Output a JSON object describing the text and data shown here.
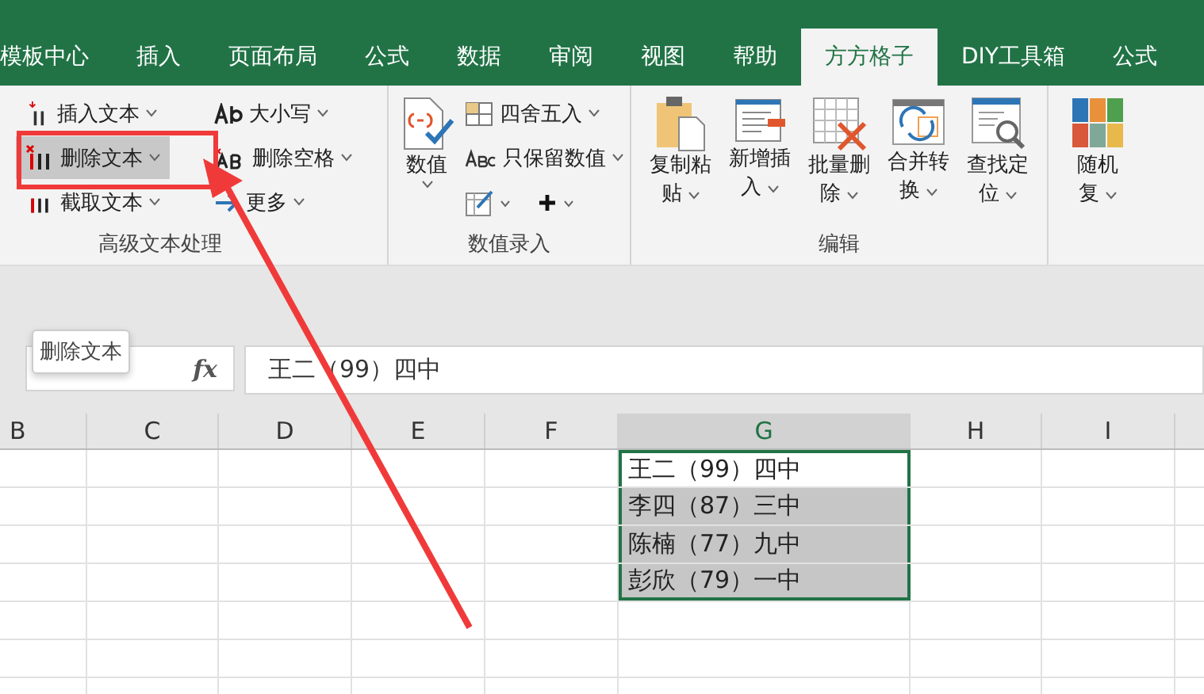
{
  "tabs": [
    {
      "label": "模板中心",
      "selected": false
    },
    {
      "label": "插入",
      "selected": false
    },
    {
      "label": "页面布局",
      "selected": false
    },
    {
      "label": "公式",
      "selected": false
    },
    {
      "label": "数据",
      "selected": false
    },
    {
      "label": "审阅",
      "selected": false
    },
    {
      "label": "视图",
      "selected": false
    },
    {
      "label": "帮助",
      "selected": false
    },
    {
      "label": "方方格子",
      "selected": true
    },
    {
      "label": "DIY工具箱",
      "selected": false
    },
    {
      "label": "公式",
      "selected": false
    }
  ],
  "ribbon": {
    "groups": [
      {
        "kind": "text-tools",
        "label": "高级文本处理",
        "columns": [
          [
            {
              "kind": "insert",
              "label": "插入文本",
              "hovered": false
            },
            {
              "kind": "delete",
              "label": "删除文本",
              "hovered": true
            },
            {
              "kind": "cut",
              "label": "截取文本",
              "hovered": false
            }
          ],
          [
            {
              "kind": "case",
              "label": "大小写",
              "hovered": false
            },
            {
              "kind": "space",
              "label": "删除空格",
              "hovered": false
            },
            {
              "kind": "more",
              "label": "更多",
              "hovered": false
            }
          ]
        ]
      },
      {
        "kind": "number-tools",
        "label": "数值录入",
        "big": {
          "label": "数值"
        },
        "items": [
          {
            "kind": "round",
            "label": "四舍五入"
          },
          {
            "kind": "keep",
            "label": "只保留数值"
          }
        ]
      },
      {
        "kind": "large-buttons",
        "label": "编辑",
        "buttons": [
          {
            "kind": "paste",
            "lines": [
              "复制粘",
              "贴"
            ]
          },
          {
            "kind": "insert-row",
            "lines": [
              "新增插",
              "入"
            ]
          },
          {
            "kind": "batch-delete",
            "lines": [
              "批量删",
              "除"
            ]
          },
          {
            "kind": "merge",
            "lines": [
              "合并转",
              "换"
            ]
          },
          {
            "kind": "find",
            "lines": [
              "查找定",
              "位"
            ]
          }
        ]
      },
      {
        "kind": "large-buttons",
        "buttons": [
          {
            "kind": "random",
            "lines": [
              "随机",
              "复"
            ]
          }
        ]
      }
    ]
  },
  "tooltip": {
    "text": "删除文本"
  },
  "formula_bar": {
    "fx": "fx",
    "content": "王二（99）四中"
  },
  "sheet": {
    "columns": [
      {
        "label": "B",
        "selected": false
      },
      {
        "label": "C",
        "selected": false
      },
      {
        "label": "D",
        "selected": false
      },
      {
        "label": "E",
        "selected": false
      },
      {
        "label": "F",
        "selected": false
      },
      {
        "label": "G",
        "selected": true
      },
      {
        "label": "H",
        "selected": false
      },
      {
        "label": "I",
        "selected": false
      }
    ],
    "cells": [
      {
        "text": "王二（99）四中",
        "highlighted": false
      },
      {
        "text": "李四（87）三中",
        "highlighted": true
      },
      {
        "text": "陈楠（77）九中",
        "highlighted": true
      },
      {
        "text": "彭欣（79）一中",
        "highlighted": true
      }
    ]
  }
}
